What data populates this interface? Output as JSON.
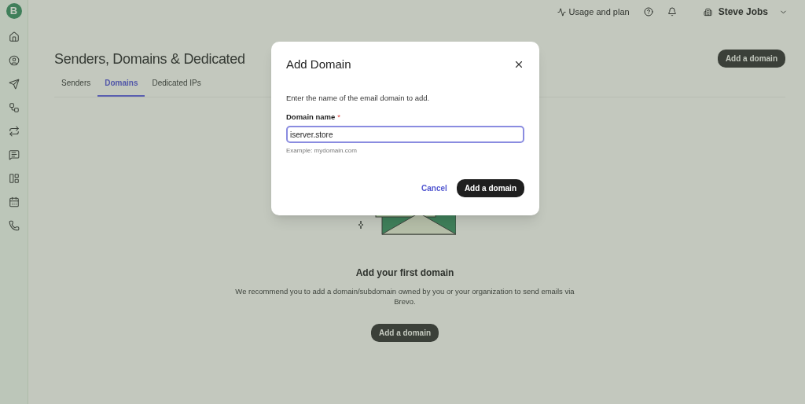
{
  "logo": "B",
  "topbar": {
    "usage": "Usage and plan",
    "user": "Steve Jobs"
  },
  "page": {
    "title": "Senders, Domains & Dedicated",
    "action": "Add a domain",
    "tabs": [
      {
        "label": "Senders",
        "selected": false
      },
      {
        "label": "Domains",
        "selected": true
      },
      {
        "label": "Dedicated IPs",
        "selected": false
      }
    ],
    "empty": {
      "title": "Add your first domain",
      "text": "We recommend you to add a domain/subdomain owned by you or your organization to send emails via Brevo.",
      "button": "Add a domain"
    }
  },
  "dialog": {
    "title": "Add Domain",
    "intro": "Enter the name of the email domain to add.",
    "field_label": "Domain name",
    "required_mark": "*",
    "value": "iserver.store",
    "hint": "Example: mydomain.com",
    "cancel": "Cancel",
    "submit": "Add a domain"
  }
}
